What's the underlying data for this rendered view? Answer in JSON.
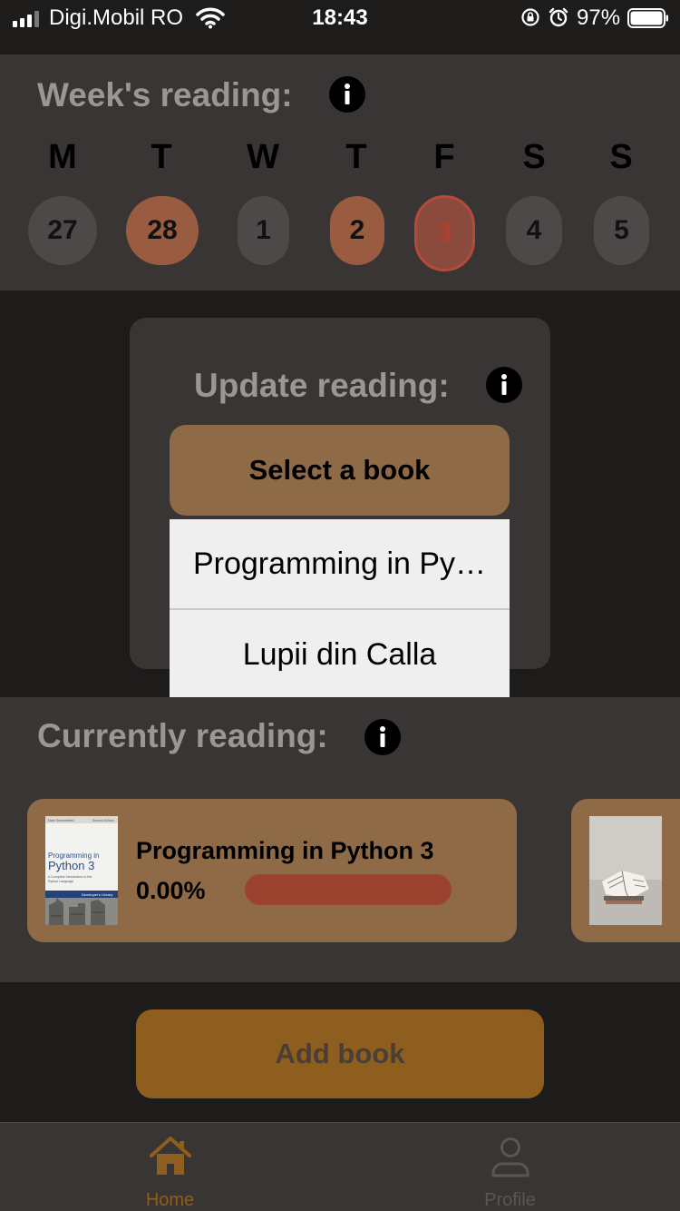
{
  "status_bar": {
    "carrier": "Digi.Mobil RO",
    "time": "18:43",
    "battery": "97%"
  },
  "week": {
    "title": "Week's reading:",
    "days": [
      {
        "letter": "M",
        "date": "27",
        "state": "inactive"
      },
      {
        "letter": "T",
        "date": "28",
        "state": "read"
      },
      {
        "letter": "W",
        "date": "1",
        "state": "inactive"
      },
      {
        "letter": "T",
        "date": "2",
        "state": "read"
      },
      {
        "letter": "F",
        "date": "3",
        "state": "today"
      },
      {
        "letter": "S",
        "date": "4",
        "state": "inactive"
      },
      {
        "letter": "S",
        "date": "5",
        "state": "inactive"
      }
    ]
  },
  "update": {
    "title": "Update reading:",
    "select_label": "Select a book",
    "options": [
      "Programming in Py…",
      "Lupii din Calla"
    ]
  },
  "current": {
    "title": "Currently reading:",
    "books": [
      {
        "title": "Programming in Python 3",
        "progress_text": "0.00%",
        "progress": 0.0,
        "cover": {
          "author": "Mark Summerfield",
          "edition": "Second Edition",
          "title_line1": "Programming in",
          "title_line2": "Python 3",
          "subtitle_line1": "A Complete Introduction to the",
          "subtitle_line2": "Python Language",
          "series": "Developer's Library"
        }
      }
    ]
  },
  "add_button": "Add book",
  "tabs": [
    {
      "label": "Home",
      "icon": "home-icon",
      "active": true
    },
    {
      "label": "Profile",
      "icon": "profile-icon",
      "active": false
    }
  ],
  "colors": {
    "accent_brown": "#8e6a47",
    "read_day": "#9a5c41",
    "today_border": "#b64a39",
    "progress_track": "#9c432f",
    "add_button": "#8e5e1e"
  }
}
